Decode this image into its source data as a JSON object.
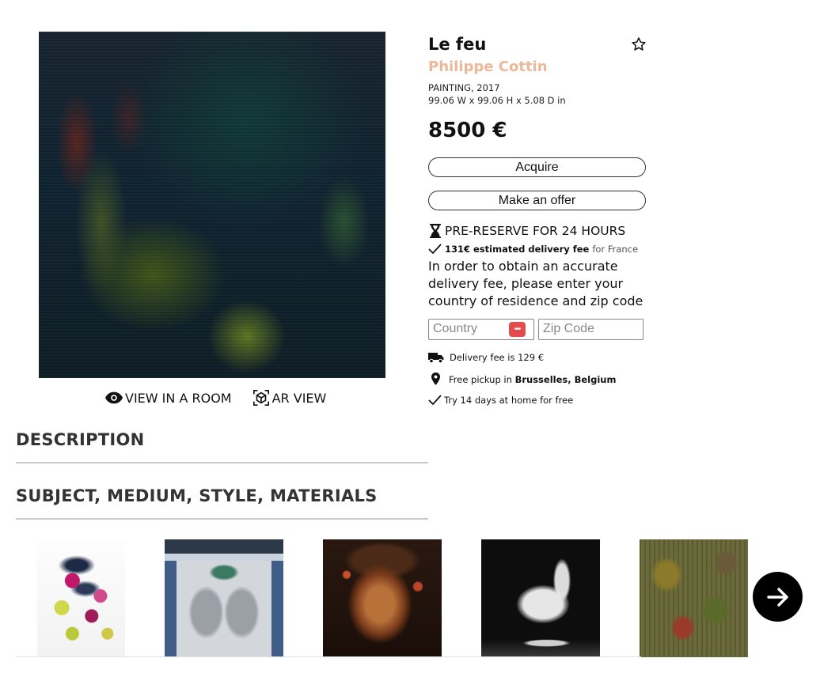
{
  "artwork": {
    "title": "Le feu",
    "artist": "Philippe Cottin",
    "category_year": "PAINTING, 2017",
    "dimensions": "99.06 W x 99.06 H x 5.08 D in",
    "price": "8500 €"
  },
  "view_links": {
    "view_in_room": "VIEW IN A ROOM",
    "ar_view": "AR VIEW"
  },
  "buttons": {
    "acquire": "Acquire",
    "make_offer": "Make an offer"
  },
  "prereserve": "PRE-RESERVE FOR 24 HOURS",
  "delivery_estimate": {
    "fee": "131€ estimated delivery fee",
    "for": "for France"
  },
  "instructions": "In order to obtain an accurate delivery fee, please enter your country of residence and zip code",
  "form": {
    "country_placeholder": "Country",
    "zip_placeholder": "Zip Code"
  },
  "features": {
    "delivery_fee": "Delivery fee is 129 €",
    "pickup_prefix": "Free pickup in",
    "pickup_location": "Brusselles, Belgium",
    "try_home": "Try 14 days at home for free"
  },
  "sections": {
    "description": "DESCRIPTION",
    "subject": "SUBJECT, MEDIUM, STYLE, MATERIALS"
  },
  "icons": {
    "favorite": "star-outline-icon",
    "view_in_room": "eye-icon",
    "ar_view": "ar-cube-icon",
    "prereserve": "hourglass-icon",
    "delivery_estimate": "checkmark-icon",
    "password_manager": "password-manager-icon",
    "delivery_fee": "truck-icon",
    "pickup": "map-pin-icon",
    "try_home": "checkmark-icon",
    "carousel_next": "arrow-right-icon"
  },
  "colors": {
    "artist": "#ebb89a",
    "password_manager": "#e34c4c",
    "next_button": "#000000"
  }
}
